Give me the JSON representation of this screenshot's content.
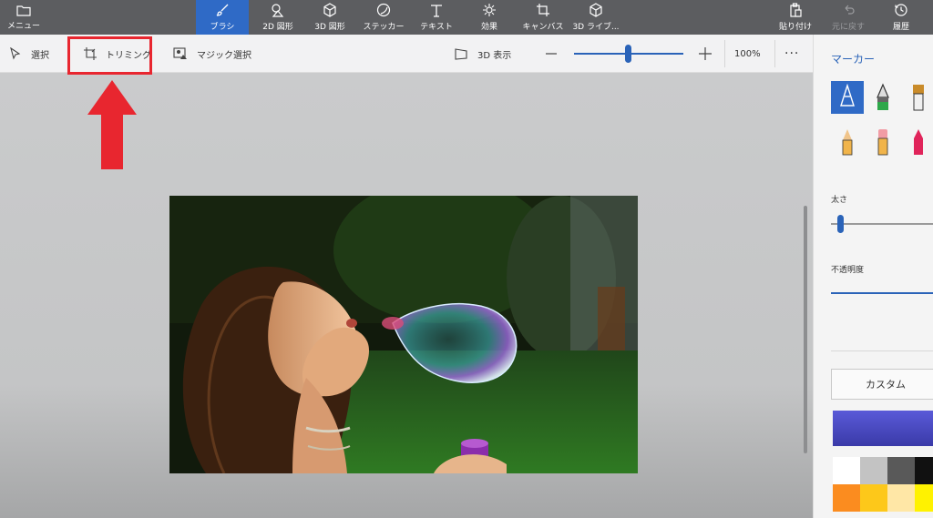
{
  "topbar": {
    "menu_label": "メニュー",
    "tabs": [
      {
        "label": "ブラシ",
        "icon": "brush-icon",
        "active": true
      },
      {
        "label": "2D 図形",
        "icon": "2d-shapes-icon"
      },
      {
        "label": "3D 図形",
        "icon": "3d-shapes-icon"
      },
      {
        "label": "ステッカー",
        "icon": "sticker-icon"
      },
      {
        "label": "テキスト",
        "icon": "text-icon"
      },
      {
        "label": "効果",
        "icon": "effects-icon"
      },
      {
        "label": "キャンバス",
        "icon": "canvas-icon"
      },
      {
        "label": "3D ライブ...",
        "icon": "3d-library-icon"
      }
    ],
    "paste_label": "貼り付け",
    "undo_label": "元に戻す",
    "history_label": "履歴"
  },
  "toolbar": {
    "select_label": "選択",
    "crop_label": "トリミング",
    "magic_select_label": "マジック選択",
    "view3d_label": "3D 表示",
    "zoom_value": "100%",
    "zoom_level": 0.5,
    "more_label": "···"
  },
  "panel": {
    "title": "マーカー",
    "size_label": "太さ",
    "size_level": 0.05,
    "opacity_label": "不透明度",
    "opacity_level": 1.0,
    "custom_label": "カスタム",
    "selected_color": "#4b4bc8",
    "palette": [
      "#ffffff",
      "#c3c3c3",
      "#595959",
      "#111111",
      "#fb8c1f",
      "#fdc81a",
      "#ffe7a6",
      "#fff200"
    ]
  },
  "colors": {
    "accent": "#2f6ac6",
    "topbar_bg": "#5c5d60",
    "annotation_red": "#e8262f"
  }
}
